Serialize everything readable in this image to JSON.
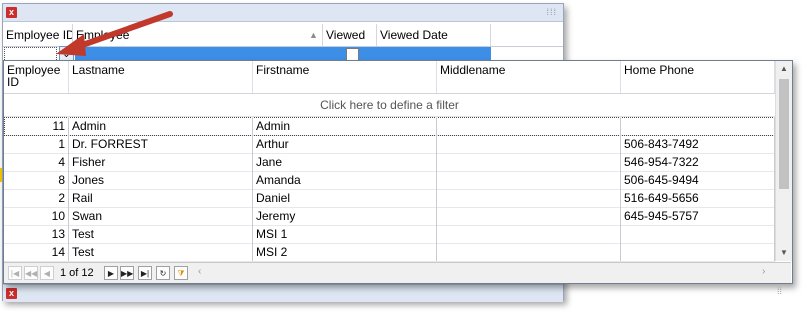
{
  "outer_grid": {
    "columns": [
      "Employee ID",
      "Employee",
      "Viewed",
      "Viewed Date"
    ],
    "sort_indicator": "▲"
  },
  "dropdown_glyph": "⌄",
  "popup": {
    "columns": [
      {
        "label": "Employee ID"
      },
      {
        "label": "Lastname"
      },
      {
        "label": "Firstname"
      },
      {
        "label": "Middlename"
      },
      {
        "label": "Home Phone"
      }
    ],
    "filter_hint": "Click here to define a filter",
    "rows": [
      {
        "id": "11",
        "lastname": "Admin",
        "firstname": "Admin",
        "middlename": "",
        "phone": ""
      },
      {
        "id": "1",
        "lastname": "Dr. FORREST",
        "firstname": "Arthur",
        "middlename": "",
        "phone": "506-843-7492"
      },
      {
        "id": "4",
        "lastname": "Fisher",
        "firstname": "Jane",
        "middlename": "",
        "phone": "546-954-7322"
      },
      {
        "id": "8",
        "lastname": "Jones",
        "firstname": "Amanda",
        "middlename": "",
        "phone": "506-645-9494"
      },
      {
        "id": "2",
        "lastname": "Rail",
        "firstname": "Daniel",
        "middlename": "",
        "phone": "516-649-5656"
      },
      {
        "id": "10",
        "lastname": "Swan",
        "firstname": "Jeremy",
        "middlename": "",
        "phone": "645-945-5757"
      },
      {
        "id": "13",
        "lastname": "Test",
        "firstname": "MSI 1",
        "middlename": "",
        "phone": ""
      },
      {
        "id": "14",
        "lastname": "Test",
        "firstname": "MSI 2",
        "middlename": "",
        "phone": ""
      }
    ],
    "pager_text": "1 of 12"
  },
  "icons": {
    "close": "x",
    "first": "|◀",
    "prev_page": "◀◀",
    "prev": "◀",
    "next": "▶",
    "next_page": "▶▶",
    "last": "▶|",
    "refresh": "↻",
    "filter": "⧩"
  },
  "colors": {
    "selection_blue": "#3d8ee6",
    "annotation_arrow": "#c0392b",
    "close_red": "#cc2d2d"
  }
}
